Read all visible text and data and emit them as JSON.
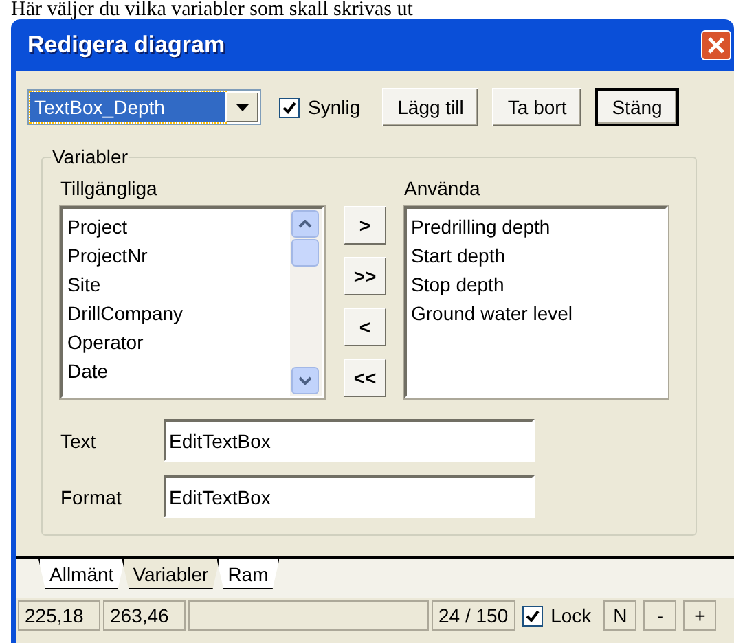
{
  "background_text": "Här väljer du vilka variabler som skall skrivas ut",
  "window": {
    "title": "Redigera diagram"
  },
  "toolbar": {
    "dropdown": {
      "value": "TextBox_Depth"
    },
    "visible_checkbox": {
      "label": "Synlig",
      "checked": true
    },
    "buttons": [
      {
        "label": "Lägg till",
        "default": false
      },
      {
        "label": "Ta bort",
        "default": false
      },
      {
        "label": "Stäng",
        "default": true
      }
    ]
  },
  "variables": {
    "title": "Variabler",
    "available": {
      "label": "Tillgängliga",
      "items": [
        "Project",
        "ProjectNr",
        "Site",
        "DrillCompany",
        "Operator",
        "Date"
      ]
    },
    "move_buttons": [
      ">",
      ">>",
      "<",
      "<<"
    ],
    "used": {
      "label": "Använda",
      "items": [
        "Predrilling depth",
        "Start depth",
        "Stop depth",
        "Ground water level"
      ]
    },
    "fields": [
      {
        "label": "Text",
        "value": "EditTextBox"
      },
      {
        "label": "Format",
        "value": "EditTextBox"
      }
    ]
  },
  "tabs": [
    {
      "label": "Allmänt",
      "selected": false
    },
    {
      "label": "Variabler",
      "selected": true
    },
    {
      "label": "Ram",
      "selected": false
    }
  ],
  "status_bar": {
    "cells": [
      "225,18",
      "263,46",
      ""
    ],
    "counter": "24 / 150",
    "lock": {
      "label": "Lock",
      "checked": true
    },
    "buttons": [
      "N",
      "-",
      "+"
    ]
  }
}
